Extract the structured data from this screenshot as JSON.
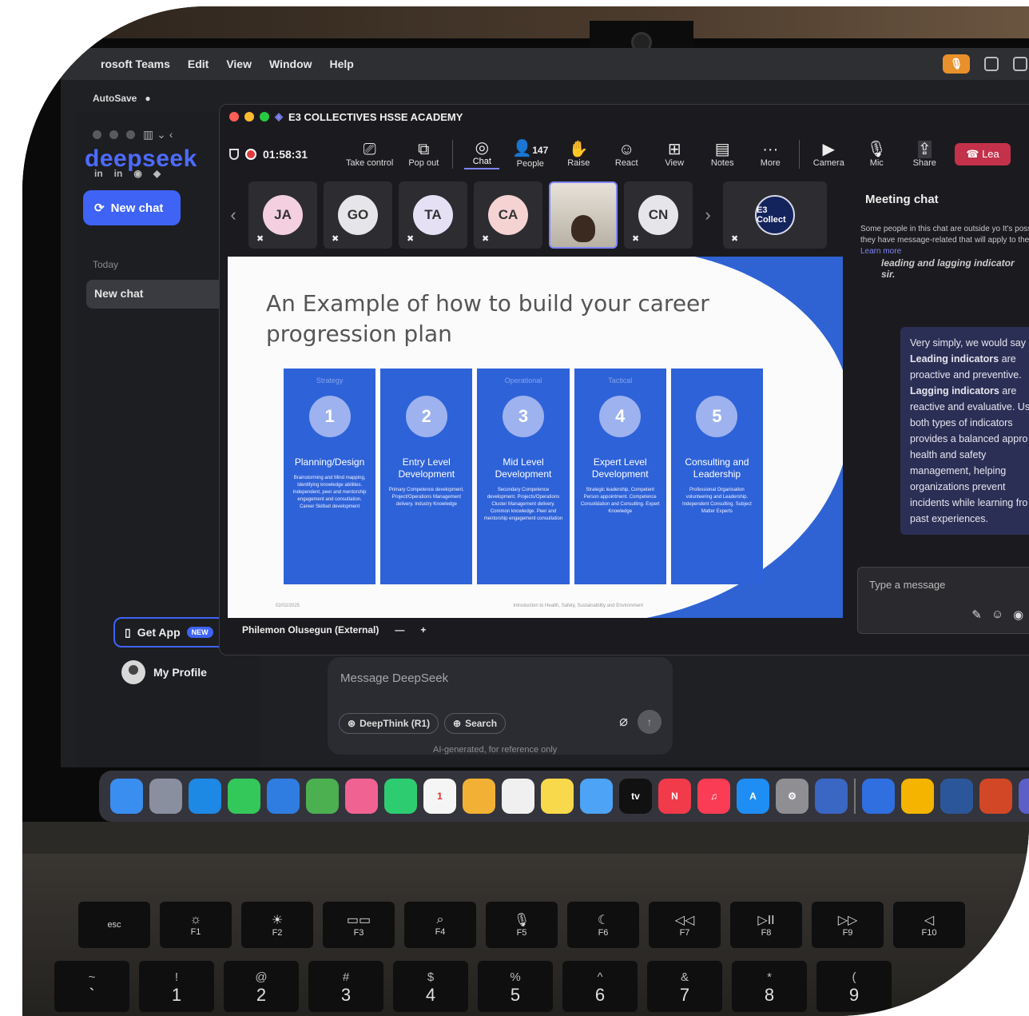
{
  "menubar": {
    "app": "rosoft Teams",
    "items": [
      "Edit",
      "View",
      "Window",
      "Help"
    ]
  },
  "word": {
    "autosave": "AutoSave"
  },
  "deepseek": {
    "logo": "deepseek",
    "new_chat": "New chat",
    "today": "Today",
    "chat_item": "New chat",
    "get_app": "Get App",
    "new_badge": "NEW",
    "my_profile": "My Profile",
    "composer_placeholder": "Message DeepSeek",
    "deepthink": "DeepThink (R1)",
    "search": "Search",
    "ai_note": "AI-generated, for reference only"
  },
  "teams": {
    "title": "E3 COLLECTIVES HSSE ACADEMY",
    "timer": "01:58:31",
    "toolbar": [
      {
        "icon": "take-control-icon",
        "glyph": "⎚",
        "label": "Take control"
      },
      {
        "icon": "pop-out-icon",
        "glyph": "⧉",
        "label": "Pop out"
      },
      {
        "icon": "chat-icon",
        "glyph": "◎",
        "label": "Chat"
      },
      {
        "icon": "people-icon",
        "glyph": "👤",
        "label": "People",
        "count": "147"
      },
      {
        "icon": "raise-hand-icon",
        "glyph": "✋",
        "label": "Raise"
      },
      {
        "icon": "react-icon",
        "glyph": "☺",
        "label": "React"
      },
      {
        "icon": "view-icon",
        "glyph": "⊞",
        "label": "View"
      },
      {
        "icon": "notes-icon",
        "glyph": "▤",
        "label": "Notes"
      },
      {
        "icon": "more-icon",
        "glyph": "···",
        "label": "More"
      },
      {
        "icon": "camera-icon",
        "glyph": "▶",
        "label": "Camera"
      },
      {
        "icon": "mic-icon",
        "glyph": "🎙",
        "label": "Mic"
      },
      {
        "icon": "share-icon",
        "glyph": "⇪",
        "label": "Share"
      }
    ],
    "leave": "Lea",
    "participants": [
      {
        "initials": "JA",
        "color": "#f3cfe0"
      },
      {
        "initials": "GO",
        "color": "#e6e6ea"
      },
      {
        "initials": "TA",
        "color": "#e6e0f5"
      },
      {
        "initials": "CA",
        "color": "#f5d3d3"
      },
      {
        "initials": "",
        "color": "video"
      },
      {
        "initials": "CN",
        "color": "#e6e6ea"
      }
    ],
    "org_tile": "E3 Collect",
    "presenter": "Philemon Olusegun (External)",
    "presenter_controls": [
      "—",
      "+"
    ]
  },
  "slide": {
    "title": "An Example of how to build your career progression plan",
    "categories": [
      "Strategy",
      "Operational",
      "Tactical"
    ],
    "phases": [
      {
        "num": "1",
        "title": "Planning/Design",
        "desc": "Brainstorming and Mind mapping, Identifying knowledge abilities. Independent, peer and mentorship engagement and consultation. Career Skillset development"
      },
      {
        "num": "2",
        "title": "Entry Level Development",
        "desc": "Primary Competence development. Project/Operations Management delivery. Industry Knowledge"
      },
      {
        "num": "3",
        "title": "Mid Level Development",
        "desc": "Secondary Competence development. Projects/Operations Cluster Management delivery. Common knowledge. Peer and mentorship engagement consultation"
      },
      {
        "num": "4",
        "title": "Expert Level Development",
        "desc": "Strategic leadership, Competent Person appointment. Competence Consolidation and Consulting. Expert Knowledge"
      },
      {
        "num": "5",
        "title": "Consulting and Leadership",
        "desc": "Professional Organisation volunteering and Leadership. Independent Consulting. Subject Matter Experts"
      }
    ],
    "footer_date": "02/02/2025",
    "footer_course": "Introduction to Health, Safety, Sustainability and Environment"
  },
  "chat": {
    "header": "Meeting chat",
    "notice": "Some people in this chat are outside yo It's possible they have message-related that will apply to the chat.",
    "learn_more": "Learn more",
    "prev_msg_1": "leading and lagging indicator",
    "prev_msg_2": "sir.",
    "bubble_1": "Very simply, we would say",
    "bubble_b1": "Leading indicators",
    "bubble_2": "are proactive and preventive.",
    "bubble_b2": "Lagging indicators",
    "bubble_3": "are reactive and evaluative. Us both types of indicators provides a balanced appro to health and safety management, helping organizations prevent incidents while learning fro past experiences.",
    "input_placeholder": "Type a message"
  },
  "dock": {
    "apps": [
      {
        "icon": "finder-icon",
        "color": "#3a8ef0",
        "label": ""
      },
      {
        "icon": "launchpad-icon",
        "color": "#8a8fa0",
        "label": ""
      },
      {
        "icon": "safari-icon",
        "color": "#1e88e5",
        "label": ""
      },
      {
        "icon": "messages-icon",
        "color": "#34c759",
        "label": ""
      },
      {
        "icon": "mail-icon",
        "color": "#2f7de1",
        "label": ""
      },
      {
        "icon": "maps-icon",
        "color": "#4caf50",
        "label": ""
      },
      {
        "icon": "photos-icon",
        "color": "#f06292",
        "label": ""
      },
      {
        "icon": "facetime-icon",
        "color": "#2ecc71",
        "label": ""
      },
      {
        "icon": "calendar-icon",
        "color": "#f5f5f5",
        "label": "1"
      },
      {
        "icon": "notes-app-icon",
        "color": "#f2b134",
        "label": ""
      },
      {
        "icon": "reminders-icon",
        "color": "#f0f0f0",
        "label": ""
      },
      {
        "icon": "stickies-icon",
        "color": "#f9d94c",
        "label": ""
      },
      {
        "icon": "freeform-icon",
        "color": "#4da3f5",
        "label": ""
      },
      {
        "icon": "tv-icon",
        "color": "#111111",
        "label": "tv"
      },
      {
        "icon": "news-icon",
        "color": "#f23b4a",
        "label": "N"
      },
      {
        "icon": "music-icon",
        "color": "#fa3c54",
        "label": "♫"
      },
      {
        "icon": "app-store-icon",
        "color": "#1e8ef5",
        "label": "A"
      },
      {
        "icon": "settings-icon",
        "color": "#8e8e93",
        "label": "⚙"
      },
      {
        "icon": "iphone-mirroring-icon",
        "color": "#3a66c4",
        "label": ""
      },
      {
        "icon": "keychain-icon",
        "color": "#2f6fe0",
        "label": ""
      },
      {
        "icon": "chrome-icon",
        "color": "#f4b400",
        "label": ""
      },
      {
        "icon": "word-icon",
        "color": "#2b579a",
        "label": ""
      },
      {
        "icon": "powerpoint-icon",
        "color": "#d24726",
        "label": ""
      },
      {
        "icon": "teams-icon",
        "color": "#5b5fc7",
        "label": ""
      }
    ]
  },
  "keyboard": {
    "fn_keys": [
      {
        "sym": "",
        "label": "esc"
      },
      {
        "sym": "☼",
        "label": "F1"
      },
      {
        "sym": "☀",
        "label": "F2"
      },
      {
        "sym": "▭▭",
        "label": "F3"
      },
      {
        "sym": "⌕",
        "label": "F4"
      },
      {
        "sym": "🎙",
        "label": "F5"
      },
      {
        "sym": "☾",
        "label": "F6"
      },
      {
        "sym": "◁◁",
        "label": "F7"
      },
      {
        "sym": "▷II",
        "label": "F8"
      },
      {
        "sym": "▷▷",
        "label": "F9"
      },
      {
        "sym": "◁",
        "label": "F10"
      }
    ],
    "num_keys": [
      {
        "top": "~",
        "main": "`"
      },
      {
        "top": "!",
        "main": "1"
      },
      {
        "top": "@",
        "main": "2"
      },
      {
        "top": "#",
        "main": "3"
      },
      {
        "top": "$",
        "main": "4"
      },
      {
        "top": "%",
        "main": "5"
      },
      {
        "top": "^",
        "main": "6"
      },
      {
        "top": "&",
        "main": "7"
      },
      {
        "top": "*",
        "main": "8"
      },
      {
        "top": "(",
        "main": "9"
      }
    ]
  }
}
